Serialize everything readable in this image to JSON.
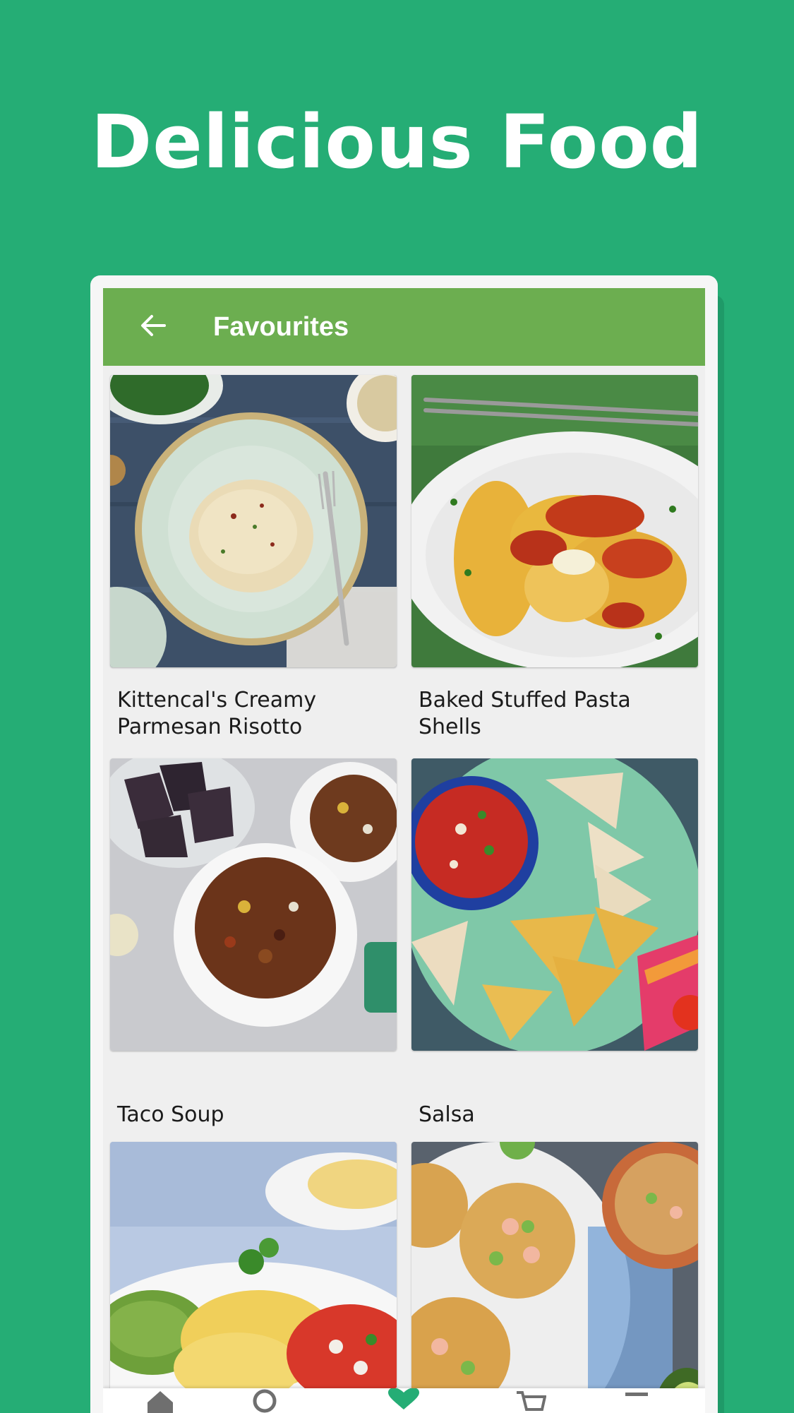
{
  "headline": "Delicious Food",
  "appbar": {
    "title": "Favourites",
    "back_icon": "arrow-left-icon"
  },
  "recipes": [
    {
      "title": "Kittencal's Creamy Parmesan Risotto",
      "image": "risotto-photo"
    },
    {
      "title": "Baked Stuffed Pasta Shells",
      "image": "stuffed-shells-photo"
    },
    {
      "title": "Taco Soup",
      "image": "taco-soup-photo"
    },
    {
      "title": "Salsa",
      "image": "salsa-photo"
    },
    {
      "title": "",
      "image": "enchiladas-photo"
    },
    {
      "title": "",
      "image": "shrimp-tostadas-photo"
    }
  ],
  "bottom_nav": [
    {
      "icon": "home-icon"
    },
    {
      "icon": "search-icon"
    },
    {
      "icon": "heart-icon",
      "active": true
    },
    {
      "icon": "cart-icon"
    },
    {
      "icon": "menu-icon"
    }
  ],
  "colors": {
    "background": "#25ad75",
    "appbar": "#6cae50",
    "accent": "#25ad75",
    "text": "#1b1b1b"
  }
}
